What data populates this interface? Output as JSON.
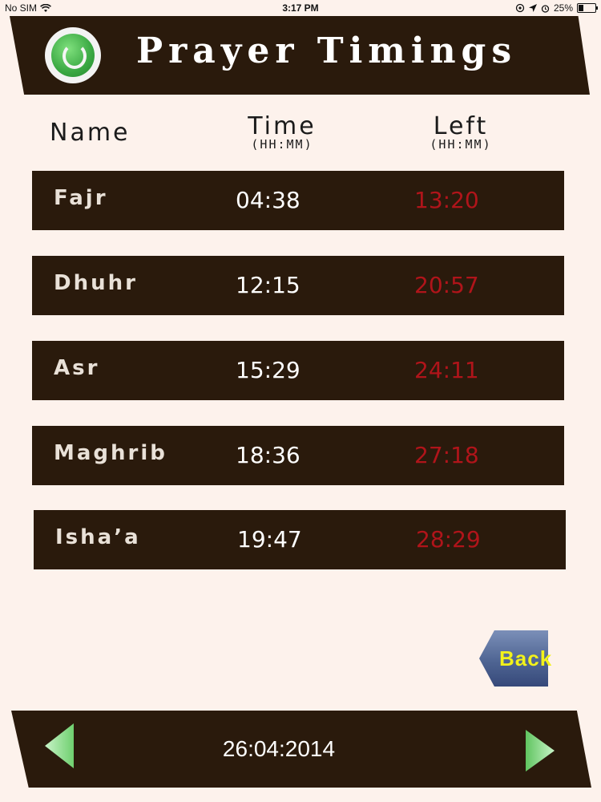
{
  "status_bar": {
    "carrier": "No SIM",
    "time": "3:17 PM",
    "battery": "25%",
    "battery_level": 0.25
  },
  "header": {
    "title": "Prayer Timings",
    "logo_icon": "app-logo-icon"
  },
  "columns": {
    "name": "Name",
    "time": "Time",
    "time_unit": "(HH:MM)",
    "left": "Left",
    "left_unit": "(HH:MM)"
  },
  "prayers": [
    {
      "name": "Fajr",
      "time": "04:38",
      "left": "13:20"
    },
    {
      "name": "Dhuhr",
      "time": "12:15",
      "left": "20:57"
    },
    {
      "name": "Asr",
      "time": "15:29",
      "left": "24:11"
    },
    {
      "name": "Maghrib",
      "time": "18:36",
      "left": "27:18"
    },
    {
      "name": "Isha’a",
      "time": "19:47",
      "left": "28:29"
    }
  ],
  "back_button": {
    "label": "Back"
  },
  "footer": {
    "date": "26:04:2014"
  },
  "colors": {
    "background": "#fdf2ec",
    "bar": "#2a1a0c",
    "left_time": "#b0141a",
    "back_label": "#f2f21a",
    "arrow": "#6fcf6f"
  }
}
